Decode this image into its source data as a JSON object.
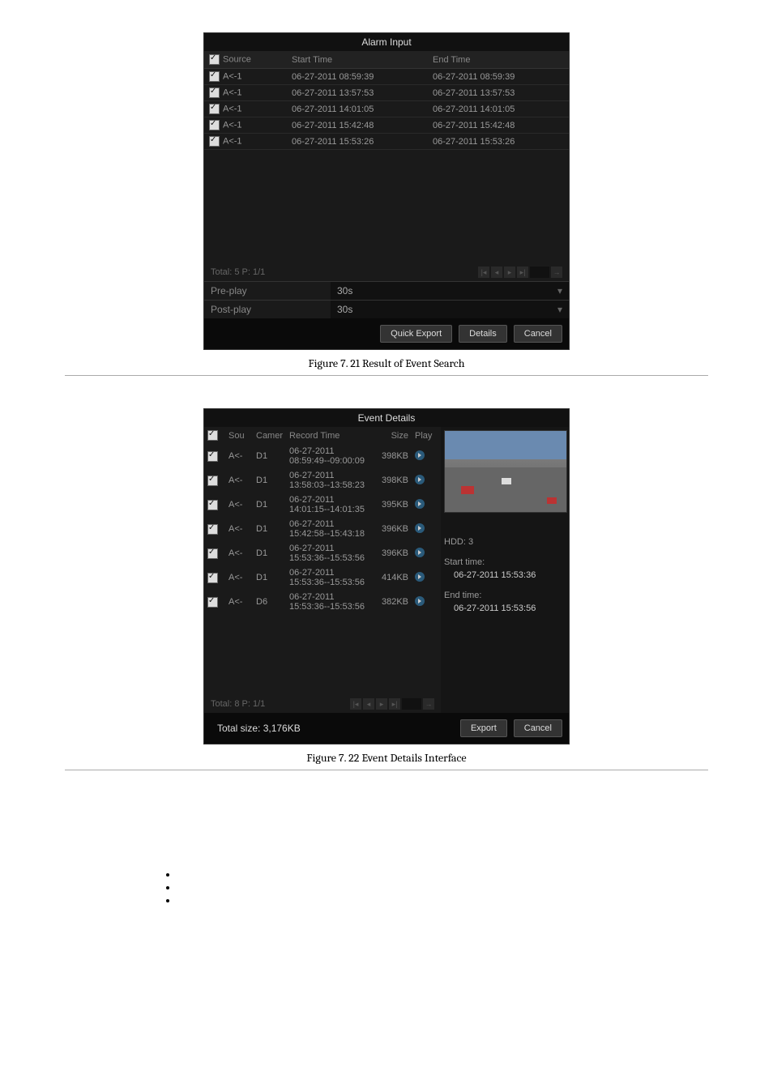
{
  "panel1": {
    "title": "Alarm Input",
    "columns": {
      "source": "Source",
      "start": "Start Time",
      "end": "End Time"
    },
    "rows": [
      {
        "source": "A<-1",
        "start": "06-27-2011 08:59:39",
        "end": "06-27-2011 08:59:39"
      },
      {
        "source": "A<-1",
        "start": "06-27-2011 13:57:53",
        "end": "06-27-2011 13:57:53"
      },
      {
        "source": "A<-1",
        "start": "06-27-2011 14:01:05",
        "end": "06-27-2011 14:01:05"
      },
      {
        "source": "A<-1",
        "start": "06-27-2011 15:42:48",
        "end": "06-27-2011 15:42:48"
      },
      {
        "source": "A<-1",
        "start": "06-27-2011 15:53:26",
        "end": "06-27-2011 15:53:26"
      }
    ],
    "total": "Total: 5  P: 1/1",
    "preplay_label": "Pre-play",
    "preplay_value": "30s",
    "postplay_label": "Post-play",
    "postplay_value": "30s",
    "buttons": {
      "quick_export": "Quick Export",
      "details": "Details",
      "cancel": "Cancel"
    }
  },
  "caption1": "Figure 7. 21 Result of Event Search",
  "panel2": {
    "title": "Event Details",
    "columns": {
      "sou": "Sou",
      "camera": "Camer",
      "record": "Record Time",
      "size": "Size",
      "play": "Play"
    },
    "rows": [
      {
        "sou": "A<-",
        "cam": "D1",
        "rec": "06-27-2011 08:59:49--09:00:09",
        "size": "398KB"
      },
      {
        "sou": "A<-",
        "cam": "D1",
        "rec": "06-27-2011 13:58:03--13:58:23",
        "size": "398KB"
      },
      {
        "sou": "A<-",
        "cam": "D1",
        "rec": "06-27-2011 14:01:15--14:01:35",
        "size": "395KB"
      },
      {
        "sou": "A<-",
        "cam": "D1",
        "rec": "06-27-2011 15:42:58--15:43:18",
        "size": "396KB"
      },
      {
        "sou": "A<-",
        "cam": "D1",
        "rec": "06-27-2011 15:53:36--15:53:56",
        "size": "396KB"
      },
      {
        "sou": "A<-",
        "cam": "D1",
        "rec": "06-27-2011 15:53:36--15:53:56",
        "size": "414KB"
      },
      {
        "sou": "A<-",
        "cam": "D6",
        "rec": "06-27-2011 15:53:36--15:53:56",
        "size": "382KB"
      }
    ],
    "total": "Total: 8  P: 1/1",
    "total_size": "Total size: 3,176KB",
    "side": {
      "hdd_label": "HDD: 3",
      "start_label": "Start time:",
      "start_value": "06-27-2011 15:53:36",
      "end_label": "End time:",
      "end_value": "06-27-2011 15:53:56"
    },
    "buttons": {
      "export": "Export",
      "cancel": "Cancel"
    }
  },
  "caption2": "Figure 7. 22 Event Details Interface"
}
